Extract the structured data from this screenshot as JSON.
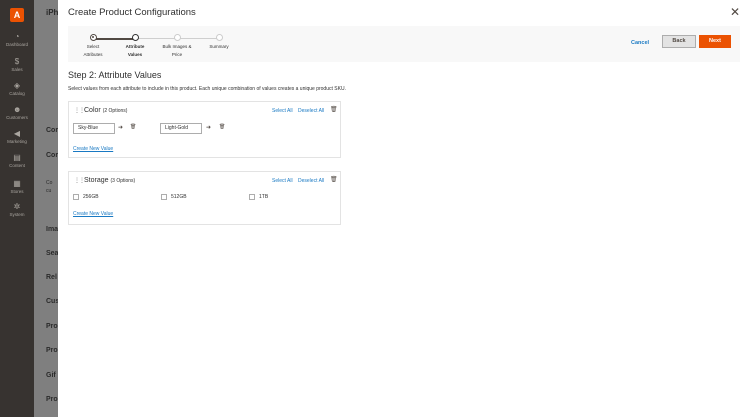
{
  "sidebar": {
    "items": [
      {
        "label": "Dashboard",
        "icon": "dashboard-icon"
      },
      {
        "label": "Sales",
        "icon": "sales-icon"
      },
      {
        "label": "Catalog",
        "icon": "catalog-icon"
      },
      {
        "label": "Customers",
        "icon": "customers-icon"
      },
      {
        "label": "Marketing",
        "icon": "marketing-icon"
      },
      {
        "label": "Content",
        "icon": "content-icon"
      },
      {
        "label": "Stores",
        "icon": "stores-icon"
      },
      {
        "label": "System",
        "icon": "system-icon"
      }
    ]
  },
  "background": {
    "headings": [
      "iPh",
      "Cor",
      "Cor",
      "Co",
      "cu",
      "Ima",
      "Sea",
      "Rel",
      "Cus",
      "Pro",
      "Pro",
      "Gif",
      "Pro"
    ]
  },
  "modal": {
    "title": "Create Product Configurations",
    "wizard": {
      "steps": [
        {
          "line1": "Select",
          "line2": "Attributes"
        },
        {
          "line1": "Attribute",
          "line2": "Values"
        },
        {
          "line1": "Bulk Images &",
          "line2": "Price"
        },
        {
          "line1": "Summary",
          "line2": ""
        }
      ],
      "cancel": "Cancel",
      "back": "Back",
      "next": "Next"
    },
    "step_title": "Step 2: Attribute Values",
    "step_desc": "Select values from each attribute to include in this product. Each unique combination of values creates a unique product SKU.",
    "attributes": [
      {
        "name": "Color",
        "count": "(2 Options)",
        "select_all": "Select All",
        "deselect_all": "Deselect All",
        "values": [
          "Sky-Blue",
          "Light-Gold"
        ],
        "create_new": "Create New Value"
      },
      {
        "name": "Storage",
        "count": "(3 Options)",
        "select_all": "Select All",
        "deselect_all": "Deselect All",
        "options": [
          "256GB",
          "512GB",
          "1TB"
        ],
        "create_new": "Create New Value"
      }
    ]
  },
  "colors": {
    "accent": "#eb5202",
    "link": "#1979c3",
    "sidebar": "#373330"
  }
}
